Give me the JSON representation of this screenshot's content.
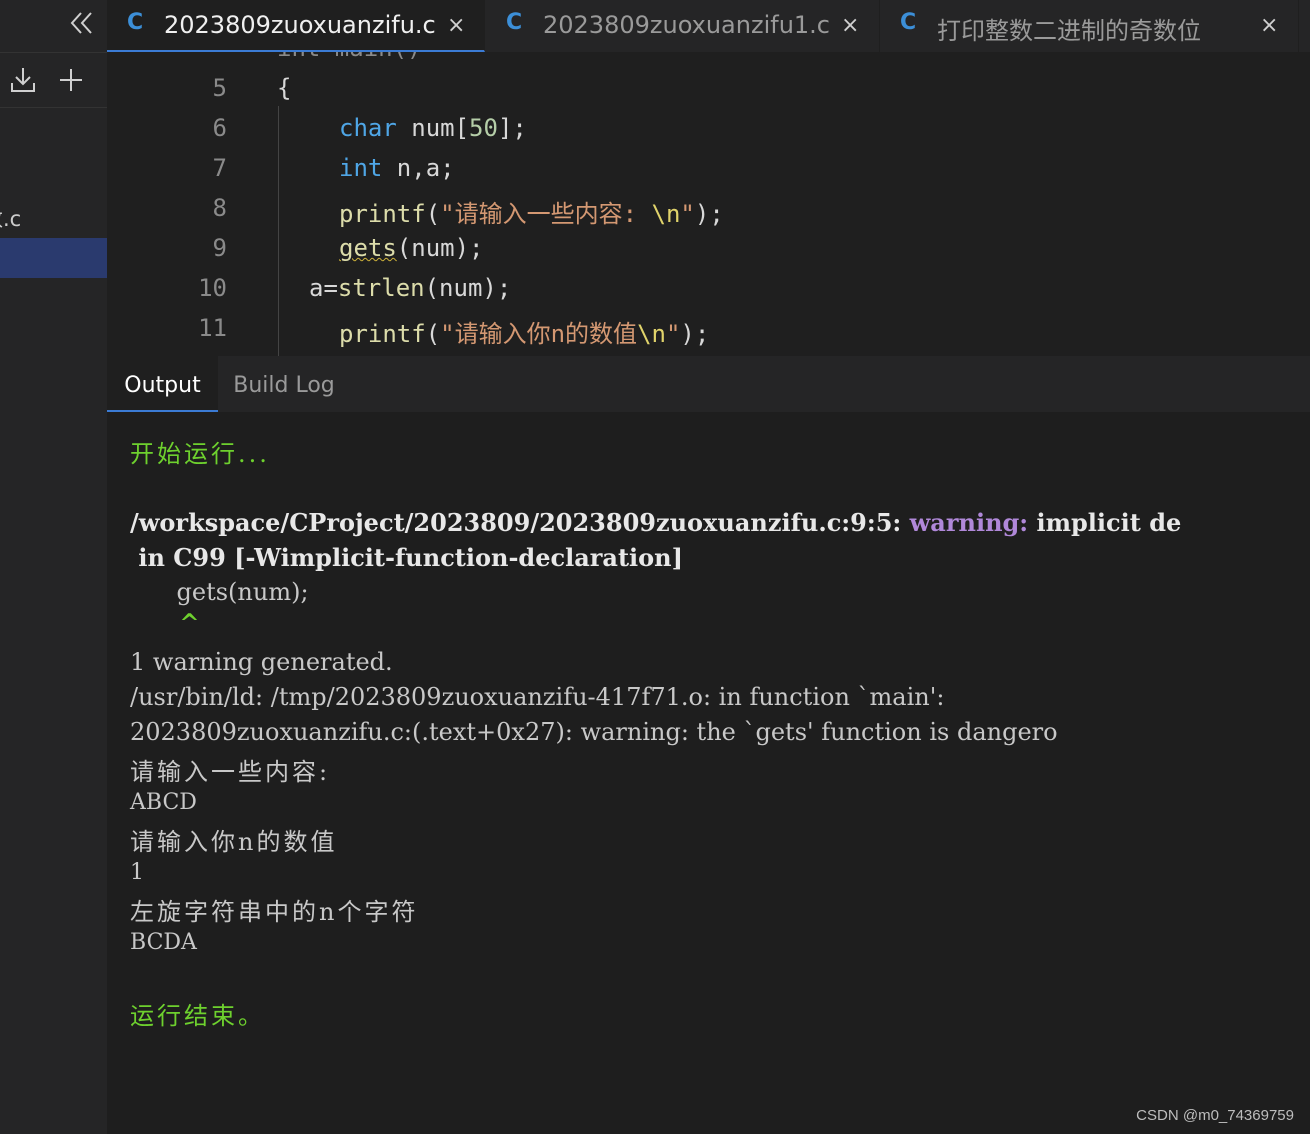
{
  "sidebar": {
    "file_label": "数.c"
  },
  "tabs": [
    {
      "icon": "C",
      "label": "2023809zuoxuanzifu.c",
      "close": "×"
    },
    {
      "icon": "C",
      "label": "2023809zuoxuanzifu1.c",
      "close": "×"
    },
    {
      "icon": "C",
      "label": "打印整数二进制的奇数位",
      "close": "×"
    }
  ],
  "editor": {
    "partial_top": "int main()",
    "lines": [
      {
        "num": "5",
        "brace": "{"
      },
      {
        "num": "6",
        "kw": "char",
        "rest": " num[",
        "n": "50",
        "tail": "];"
      },
      {
        "num": "7",
        "kw": "int",
        "rest": " n,a;"
      },
      {
        "num": "8",
        "fn": "printf",
        "open": "(",
        "str": "\"请输入一些内容: ",
        "esc": "\\n",
        "strend": "\"",
        "close": ");"
      },
      {
        "num": "9",
        "fn": "gets",
        "rest": "(num);"
      },
      {
        "num": "10",
        "a": "a=",
        "fn": "strlen",
        "rest": "(num);"
      },
      {
        "num": "11",
        "fn": "printf",
        "open": "(",
        "str": "\"请输入你n的数值",
        "esc": "\\n",
        "strend": "\"",
        "close": ");"
      }
    ]
  },
  "panel": {
    "tab_output": "Output",
    "tab_build": "Build Log"
  },
  "output": {
    "start": "开始运行...",
    "path": "/workspace/CProject/2023809/2023809zuoxuanzifu.c:9:5: ",
    "warning_word": "warning:",
    "warn_rest": " implicit de",
    "warn_line2": " in C99 [-Wimplicit-function-declaration]",
    "code_echo": "    gets(num);",
    "caret": "    ^",
    "gen": "1 warning generated.",
    "ld": "/usr/bin/ld: /tmp/2023809zuoxuanzifu-417f71.o: in function `main':",
    "gets_warn": "2023809zuoxuanzifu.c:(.text+0x27): warning: the `gets' function is dangero",
    "prompt1": "请输入一些内容:",
    "input1": "ABCD",
    "prompt2": "请输入你n的数值",
    "input2": "1",
    "prompt3": "左旋字符串中的n个字符",
    "result": "BCDA",
    "end": "运行结束。"
  },
  "watermark": "CSDN @m0_74369759"
}
